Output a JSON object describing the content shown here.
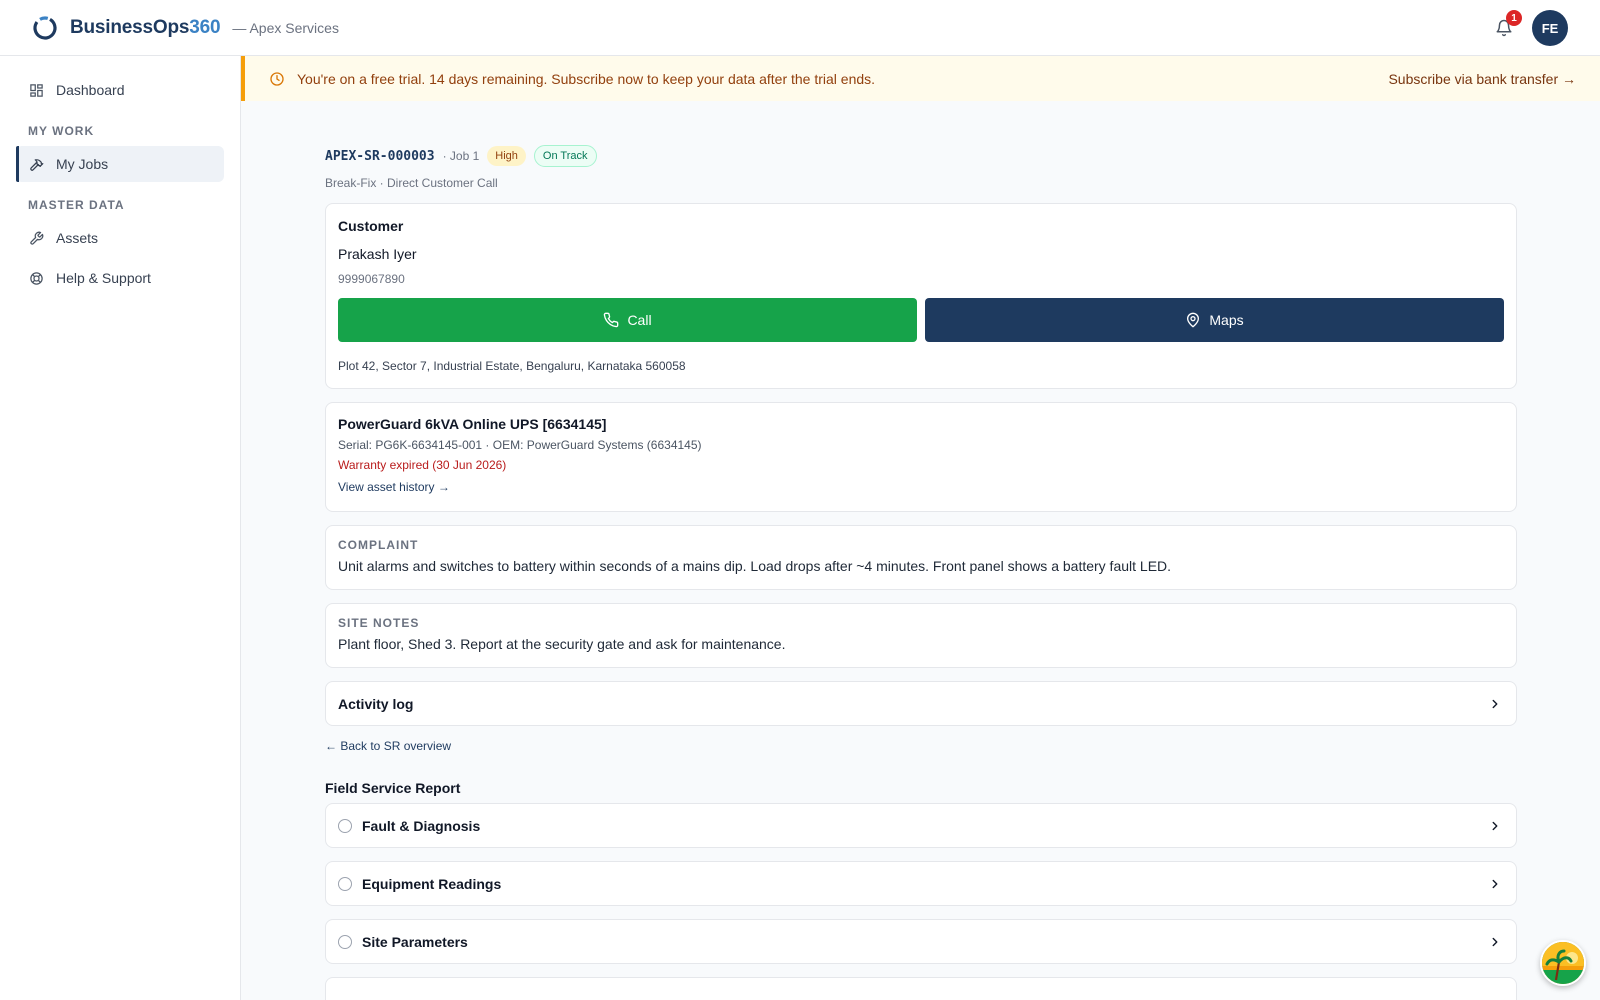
{
  "header": {
    "brand_name": "BusinessOps",
    "brand_number": "360",
    "org": "— Apex Services",
    "notification_count": "1",
    "avatar_initials": "FE"
  },
  "sidebar": {
    "dashboard": "Dashboard",
    "section_my_work": "MY WORK",
    "my_jobs": "My Jobs",
    "section_master_data": "MASTER DATA",
    "assets": "Assets",
    "help": "Help & Support"
  },
  "banner": {
    "text": "You're on a free trial. 14 days remaining. Subscribe now to keep your data after the trial ends.",
    "link": "Subscribe via bank transfer →"
  },
  "job": {
    "sr_id": "APEX-SR-000003",
    "job_label": "· Job 1",
    "priority": "High",
    "status": "On Track",
    "subtitle": "Break-Fix · Direct Customer Call"
  },
  "customer": {
    "title": "Customer",
    "name": "Prakash Iyer",
    "phone": "9999067890",
    "call_label": "Call",
    "maps_label": "Maps",
    "address": "Plot 42, Sector 7, Industrial Estate, Bengaluru, Karnataka 560058"
  },
  "asset": {
    "title": "PowerGuard 6kVA Online UPS [6634145]",
    "meta": "Serial: PG6K-6634145-001 · OEM: PowerGuard Systems (6634145)",
    "warranty": "Warranty expired (30 Jun 2026)",
    "history_link": "View asset history →"
  },
  "complaint": {
    "label": "COMPLAINT",
    "text": "Unit alarms and switches to battery within seconds of a mains dip. Load drops after ~4 minutes. Front panel shows a battery fault LED."
  },
  "site_notes": {
    "label": "SITE NOTES",
    "text": "Plant floor, Shed 3. Report at the security gate and ask for maintenance."
  },
  "activity_log": "Activity log",
  "back_link": "← Back to SR overview",
  "fsr": {
    "title": "Field Service Report",
    "sections": [
      "Fault & Diagnosis",
      "Equipment Readings",
      "Site Parameters"
    ]
  },
  "colors": {
    "primary": "#1e3a5f",
    "call_green": "#16a34a",
    "warning_bg": "#fffbeb",
    "warranty_red": "#b91c1c"
  }
}
